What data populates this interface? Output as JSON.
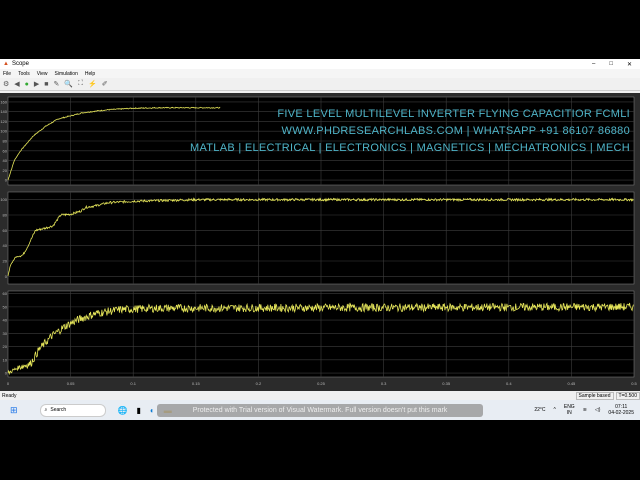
{
  "window": {
    "title": "Scope",
    "controls": [
      "–",
      "□",
      "✕"
    ]
  },
  "menu": [
    "File",
    "Tools",
    "View",
    "Simulation",
    "Help"
  ],
  "overlay": {
    "line1": "FIVE LEVEL MULTILEVEL INVERTER FLYING CAPACITIOR FCMLI",
    "line2": "WWW.PHDRESEARCHLABS.COM | WHATSAPP +91 86107 86880",
    "line3": "MATLAB | ELECTRICAL | ELECTRONICS | MAGNETICS | MECHATRONICS | MECH"
  },
  "status": {
    "left": "Ready",
    "mode": "Sample based",
    "time": "T=0.500"
  },
  "taskbar": {
    "search": "Search",
    "weather": "22°C",
    "lang": "ENG",
    "region": "IN",
    "time": "07:11",
    "date": "04-02-2025",
    "watermark": "Protected with Trial version of Visual Watermark. Full version doesn't put this mark"
  },
  "colors": {
    "trace": "#e6e65a",
    "grid": "#3c3c3c",
    "axes": "#000000"
  },
  "chart_data": [
    {
      "type": "line",
      "ylim": [
        -10,
        170
      ],
      "yticks": [
        0,
        20,
        40,
        60,
        80,
        100,
        120,
        140,
        160
      ],
      "xlim": [
        0,
        0.5
      ],
      "ripple": 1,
      "points": [
        [
          0,
          0
        ],
        [
          0.005,
          40
        ],
        [
          0.01,
          60
        ],
        [
          0.02,
          90
        ],
        [
          0.03,
          110
        ],
        [
          0.04,
          125
        ],
        [
          0.06,
          138
        ],
        [
          0.08,
          144
        ],
        [
          0.1,
          147
        ],
        [
          0.12,
          148
        ],
        [
          0.17,
          148
        ]
      ]
    },
    {
      "type": "line",
      "ylim": [
        -10,
        110
      ],
      "yticks": [
        0,
        20,
        40,
        60,
        80,
        100
      ],
      "xlim": [
        0,
        0.5
      ],
      "ripple": 1.5,
      "points": [
        [
          0,
          0
        ],
        [
          0.002,
          15
        ],
        [
          0.006,
          25
        ],
        [
          0.012,
          28
        ],
        [
          0.016,
          40
        ],
        [
          0.022,
          60
        ],
        [
          0.03,
          63
        ],
        [
          0.036,
          66
        ],
        [
          0.042,
          80
        ],
        [
          0.05,
          81
        ],
        [
          0.058,
          85
        ],
        [
          0.062,
          90
        ],
        [
          0.07,
          92
        ],
        [
          0.08,
          96
        ],
        [
          0.1,
          98
        ],
        [
          0.15,
          100
        ],
        [
          0.5,
          100
        ]
      ]
    },
    {
      "type": "line",
      "ylim": [
        -3,
        62
      ],
      "yticks": [
        0,
        10,
        20,
        30,
        40,
        50,
        60
      ],
      "xlim": [
        0,
        0.5
      ],
      "ripple": 3,
      "points": [
        [
          0,
          0
        ],
        [
          0.01,
          5
        ],
        [
          0.018,
          7
        ],
        [
          0.025,
          18
        ],
        [
          0.035,
          28
        ],
        [
          0.045,
          35
        ],
        [
          0.055,
          40
        ],
        [
          0.07,
          45
        ],
        [
          0.09,
          48
        ],
        [
          0.12,
          49
        ],
        [
          0.5,
          50
        ]
      ]
    }
  ],
  "xticks": [
    "0",
    "0.05",
    "0.1",
    "0.15",
    "0.2",
    "0.25",
    "0.3",
    "0.35",
    "0.4",
    "0.45",
    "0.5"
  ]
}
